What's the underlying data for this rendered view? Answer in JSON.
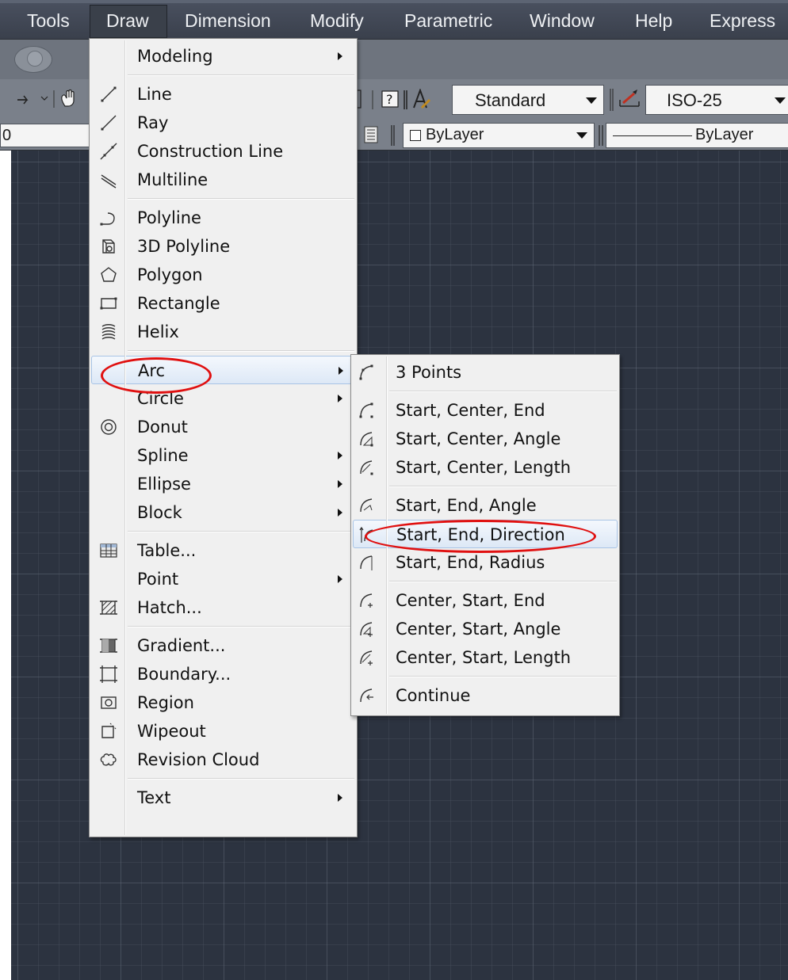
{
  "menubar": {
    "items": [
      "Tools",
      "Draw",
      "Dimension",
      "Modify",
      "Parametric",
      "Window",
      "Help",
      "Express"
    ]
  },
  "toolbar": {
    "text_style": "Standard",
    "dim_style": "ISO-25",
    "layer_value": "0",
    "color": "ByLayer",
    "linetype": "ByLayer",
    "help_glyph": "?"
  },
  "draw_menu": {
    "groups": [
      [
        {
          "label": "Modeling",
          "icon": "none",
          "submenu": true
        }
      ],
      [
        {
          "label": "Line",
          "icon": "line-icon"
        },
        {
          "label": "Ray",
          "icon": "ray-icon"
        },
        {
          "label": "Construction Line",
          "icon": "construction-line-icon"
        },
        {
          "label": "Multiline",
          "icon": "multiline-icon"
        }
      ],
      [
        {
          "label": "Polyline",
          "icon": "polyline-icon"
        },
        {
          "label": "3D Polyline",
          "icon": "3d-polyline-icon"
        },
        {
          "label": "Polygon",
          "icon": "polygon-icon"
        },
        {
          "label": "Rectangle",
          "icon": "rectangle-icon"
        },
        {
          "label": "Helix",
          "icon": "helix-icon"
        }
      ],
      [
        {
          "label": "Arc",
          "icon": "none",
          "submenu": true,
          "highlighted": true
        },
        {
          "label": "Circle",
          "icon": "none",
          "submenu": true
        },
        {
          "label": "Donut",
          "icon": "donut-icon"
        },
        {
          "label": "Spline",
          "icon": "none",
          "submenu": true
        },
        {
          "label": "Ellipse",
          "icon": "none",
          "submenu": true
        },
        {
          "label": "Block",
          "icon": "none",
          "submenu": true
        }
      ],
      [
        {
          "label": "Table...",
          "icon": "table-icon"
        },
        {
          "label": "Point",
          "icon": "none",
          "submenu": true
        },
        {
          "label": "Hatch...",
          "icon": "hatch-icon"
        }
      ],
      [
        {
          "label": "Gradient...",
          "icon": "gradient-icon"
        },
        {
          "label": "Boundary...",
          "icon": "boundary-icon"
        },
        {
          "label": "Region",
          "icon": "region-icon"
        },
        {
          "label": "Wipeout",
          "icon": "wipeout-icon"
        },
        {
          "label": "Revision Cloud",
          "icon": "revision-cloud-icon"
        }
      ],
      [
        {
          "label": "Text",
          "icon": "none",
          "submenu": true
        }
      ]
    ]
  },
  "arc_submenu": {
    "groups": [
      [
        {
          "label": "3 Points",
          "icon": "arc-3points-icon"
        }
      ],
      [
        {
          "label": "Start, Center, End",
          "icon": "arc-sce-icon"
        },
        {
          "label": "Start, Center, Angle",
          "icon": "arc-sca-icon"
        },
        {
          "label": "Start, Center, Length",
          "icon": "arc-scl-icon"
        }
      ],
      [
        {
          "label": "Start, End, Angle",
          "icon": "arc-sea-icon"
        },
        {
          "label": "Start, End, Direction",
          "icon": "arc-sed-icon",
          "highlighted": true
        },
        {
          "label": "Start, End, Radius",
          "icon": "arc-ser-icon"
        }
      ],
      [
        {
          "label": "Center, Start, End",
          "icon": "arc-cse-icon"
        },
        {
          "label": "Center, Start, Angle",
          "icon": "arc-csa-icon"
        },
        {
          "label": "Center, Start, Length",
          "icon": "arc-csl-icon"
        }
      ],
      [
        {
          "label": "Continue",
          "icon": "arc-continue-icon"
        }
      ]
    ]
  },
  "colors": {
    "canvas": "#2c3340",
    "menubar": "#3e4450",
    "highlight_border": "#a8c4e6",
    "annotation_red": "#e01010"
  }
}
